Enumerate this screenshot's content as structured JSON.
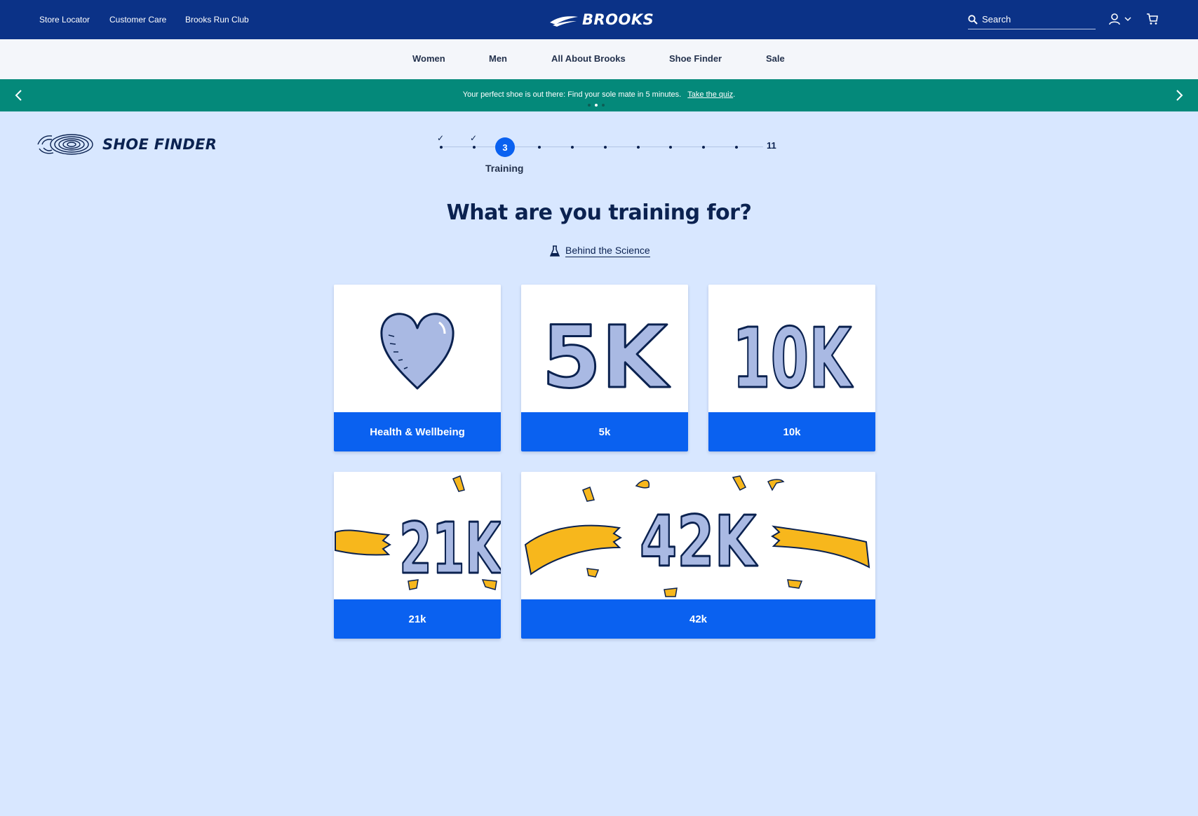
{
  "header": {
    "utility_links": [
      "Store Locator",
      "Customer Care",
      "Brooks Run Club"
    ],
    "logo_text": "BROOKS",
    "search_placeholder": "Search"
  },
  "nav": {
    "items": [
      "Women",
      "Men",
      "All About Brooks",
      "Shoe Finder",
      "Sale"
    ]
  },
  "promo": {
    "text": "Your perfect shoe is out there: Find your sole mate in 5 minutes.",
    "link": "Take the quiz",
    "link_suffix": ".",
    "dots": 3,
    "active_dot": 2
  },
  "finder": {
    "title": "SHOE FINDER",
    "current_step": "3",
    "current_label": "Training",
    "total_steps": "11"
  },
  "question": {
    "title": "What are you training for?",
    "science_link": "Behind the Science"
  },
  "options": [
    {
      "label": "Health & Wellbeing",
      "art": "heart-illustration"
    },
    {
      "label": "5k",
      "art": "5k-illustration"
    },
    {
      "label": "10k",
      "art": "10k-illustration"
    },
    {
      "label": "21k",
      "art": "21k-illustration"
    },
    {
      "label": "42k",
      "art": "42k-illustration"
    }
  ],
  "colors": {
    "header_bg": "#0b3287",
    "promo_bg": "#04897a",
    "page_bg": "#d8e7ff",
    "accent_blue": "#0a61f0",
    "art_blue": "#a9b9e3",
    "art_yellow": "#f7b71c",
    "ink": "#0b2250"
  }
}
